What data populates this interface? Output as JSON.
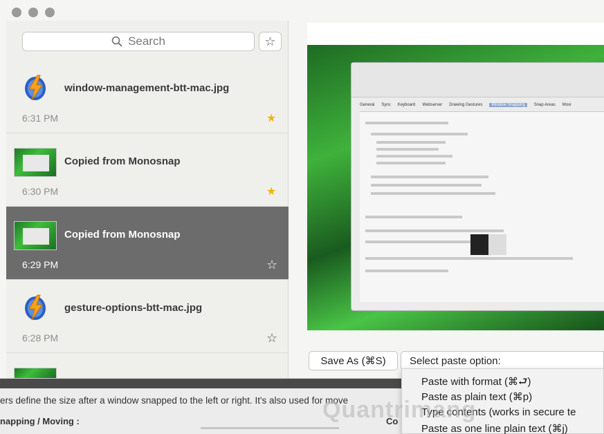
{
  "search": {
    "placeholder": "Search"
  },
  "toolbar": {
    "favorites_icon": "star-outline-icon"
  },
  "items": [
    {
      "title": "window-management-btt-mac.jpg",
      "time": "6:31 PM",
      "favorite": true,
      "thumb": "btt-icon"
    },
    {
      "title": "Copied from Monosnap",
      "time": "6:30 PM",
      "favorite": true,
      "thumb": "screenshot"
    },
    {
      "title": "Copied from Monosnap",
      "time": "6:29 PM",
      "favorite": false,
      "thumb": "screenshot",
      "selected": true
    },
    {
      "title": "gesture-options-btt-mac.jpg",
      "time": "6:28 PM",
      "favorite": false,
      "thumb": "btt-icon"
    }
  ],
  "star_filled": "★",
  "star_outline": "☆",
  "actions": {
    "save_as": "Save As (⌘S)",
    "paste_select": "Select paste option:"
  },
  "paste_options": [
    "Paste with format (⌘⮐)",
    "Paste as plain text (⌘p)",
    "Type contents (works in secure te",
    "Paste as one line plain text (⌘j)"
  ],
  "background_text": {
    "line1": "ers define the size after a window snapped to the left or right. It's also used for move",
    "line2": "napping / Moving :",
    "line3": "Co"
  },
  "watermark": "Quantrimang",
  "preview_dialog": {
    "tabs": [
      "General",
      "Sync",
      "Keyboard",
      "Webserver",
      "Drawing Gestures",
      "Window Snapping",
      "Snap Areas",
      "Movi"
    ],
    "active_tab": "Window Snapping"
  },
  "colors": {
    "selected_row": "#6c6c6c",
    "star_on": "#f4b400"
  }
}
